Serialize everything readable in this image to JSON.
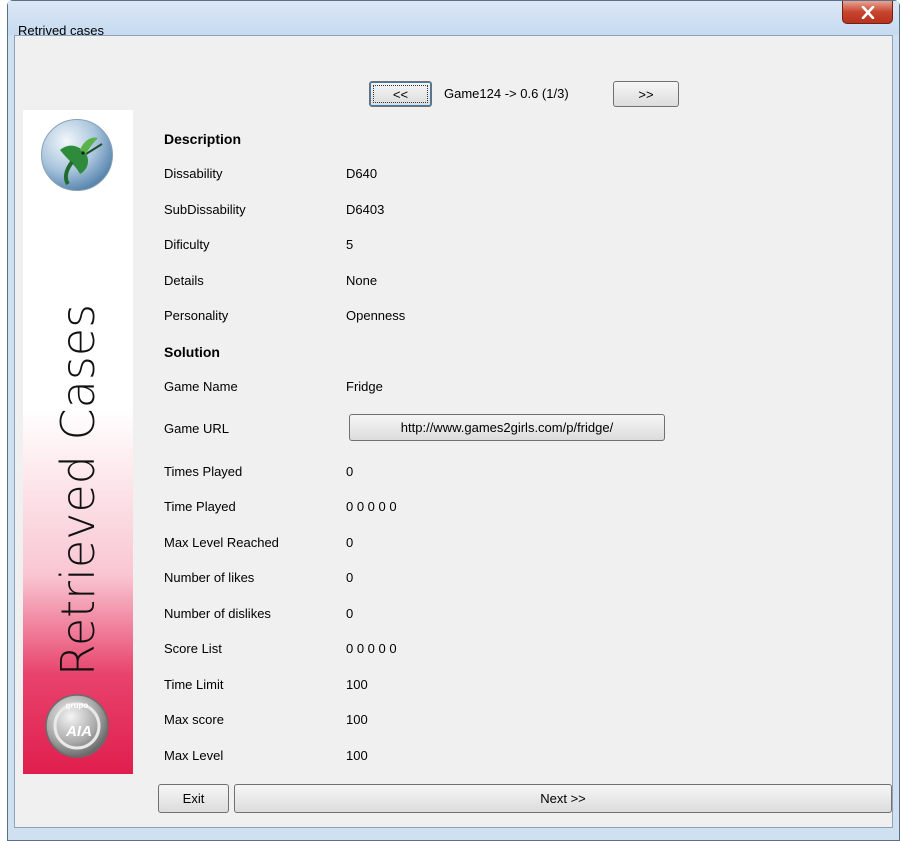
{
  "window": {
    "title": "Retrived cases"
  },
  "banner": {
    "title": "Retrieved Cases",
    "logo_bottom_text": "AIA",
    "logo_bottom_arc_text": "grupo"
  },
  "nav": {
    "prev_label": "<<",
    "next_label": ">>",
    "case_label": "Game124 -> 0.6 (1/3)"
  },
  "description": {
    "heading": "Description",
    "rows": [
      {
        "label": "Dissability",
        "value": "D640"
      },
      {
        "label": "SubDissability",
        "value": "D6403"
      },
      {
        "label": "Dificulty",
        "value": "5"
      },
      {
        "label": "Details",
        "value": "None"
      },
      {
        "label": "Personality",
        "value": "Openness"
      }
    ]
  },
  "solution": {
    "heading": "Solution",
    "game_name_label": "Game Name",
    "game_name_value": "Fridge",
    "game_url_label": "Game URL",
    "game_url_value": "http://www.games2girls.com/p/fridge/",
    "rows": [
      {
        "label": "Times Played",
        "value": "0"
      },
      {
        "label": "Time Played",
        "value": "0 0 0 0 0"
      },
      {
        "label": "Max Level Reached",
        "value": "0"
      },
      {
        "label": "Number of likes",
        "value": "0"
      },
      {
        "label": "Number of dislikes",
        "value": "0"
      },
      {
        "label": "Score List",
        "value": "0 0 0 0 0"
      },
      {
        "label": "Time Limit",
        "value": "100"
      },
      {
        "label": "Max score",
        "value": "100"
      },
      {
        "label": "Max Level",
        "value": "100"
      }
    ]
  },
  "footer": {
    "exit_label": "Exit",
    "next_label": "Next >>"
  },
  "icons": {
    "close": "close-icon",
    "bird_logo": "hummingbird-logo-icon",
    "gaia_logo": "gaia-logo-icon"
  },
  "colors": {
    "banner_pink": "#e01e4e",
    "client_bg": "#f0f0f0",
    "close_red": "#c7442f"
  }
}
